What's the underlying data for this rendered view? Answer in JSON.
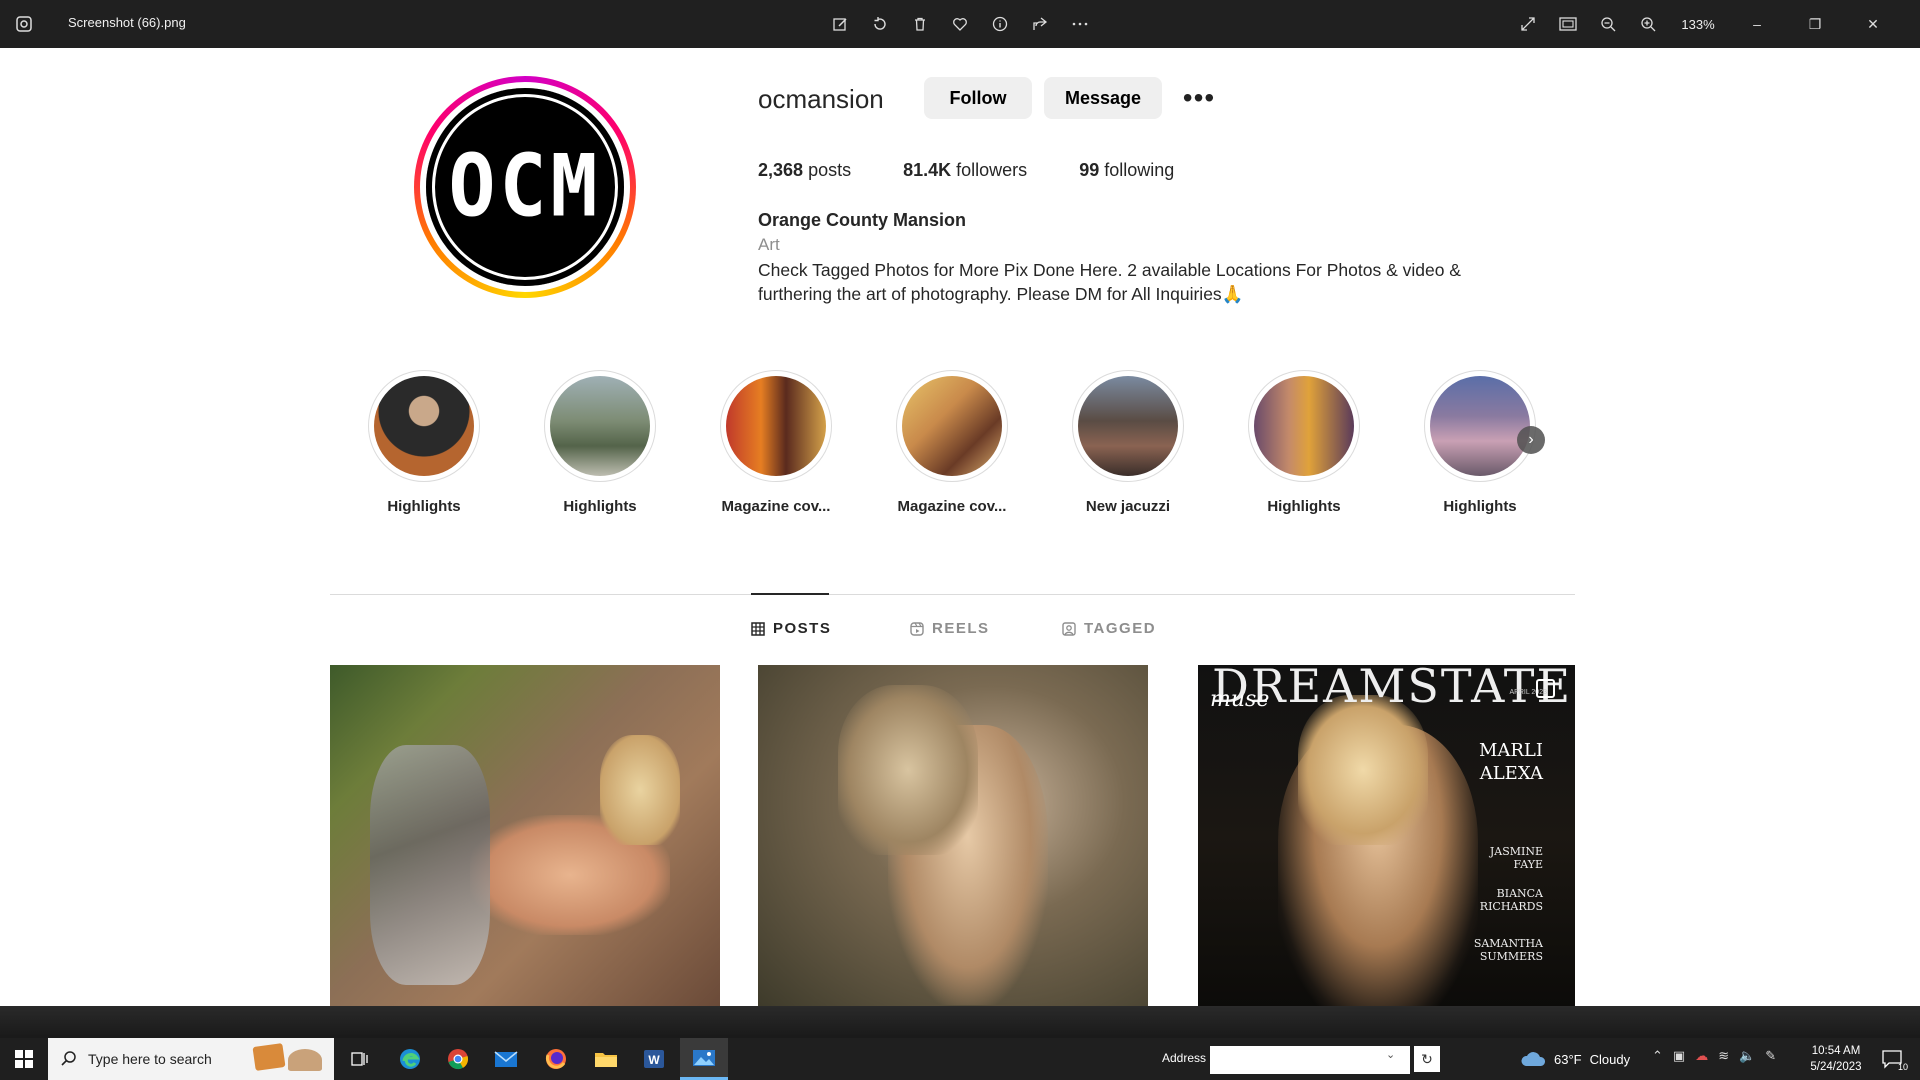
{
  "photos_app": {
    "filename": "Screenshot (66).png",
    "zoom": "133%",
    "tools": [
      "edit-icon",
      "rotate-icon",
      "delete-icon",
      "heart-icon",
      "info-icon",
      "share-icon",
      "more-icon"
    ],
    "right_tools": [
      "fullscreen-icon",
      "fit-icon",
      "zoom-out-icon",
      "zoom-in-icon"
    ]
  },
  "profile": {
    "logo_text": "OCM",
    "username": "ocmansion",
    "follow_label": "Follow",
    "message_label": "Message",
    "more_label": "•••",
    "posts": "2,368",
    "posts_label": "posts",
    "followers": "81.4K",
    "followers_label": "followers",
    "following": "99",
    "following_label": "following",
    "full_name": "Orange County Mansion",
    "category": "Art",
    "bio": "Check Tagged Photos for More Pix Done Here. 2 available Locations For Photos & video & furthering the art of photography. Please DM for All Inquiries🙏"
  },
  "highlights": [
    {
      "label": "Highlights"
    },
    {
      "label": "Highlights"
    },
    {
      "label": "Magazine cov..."
    },
    {
      "label": "Magazine cov..."
    },
    {
      "label": "New jacuzzi"
    },
    {
      "label": "Highlights"
    },
    {
      "label": "Highlights"
    }
  ],
  "tabs": {
    "posts": "POSTS",
    "reels": "REELS",
    "tagged": "TAGGED",
    "active": "POSTS"
  },
  "posts_grid": {
    "magazine_cover": {
      "title": "DREAMSTATE",
      "subtitle": "muse",
      "issue": "APRIL 2023",
      "cover_star_line1": "MARLI",
      "cover_star_line2": "ALEXA",
      "name1a": "JASMINE",
      "name1b": "FAYE",
      "name2a": "BIANCA",
      "name2b": "RICHARDS",
      "name3a": "SAMANTHA",
      "name3b": "SUMMERS"
    }
  },
  "taskbar": {
    "search_placeholder": "Type here to search",
    "apps": [
      "task-view-icon",
      "edge-icon",
      "chrome-icon",
      "mail-icon",
      "firefox-icon",
      "file-explorer-icon",
      "word-icon",
      "photos-icon"
    ],
    "address_label": "Address",
    "weather_temp": "63°F",
    "weather_desc": "Cloudy",
    "time": "10:54 AM",
    "date": "5/24/2023",
    "notification_count": "10"
  }
}
